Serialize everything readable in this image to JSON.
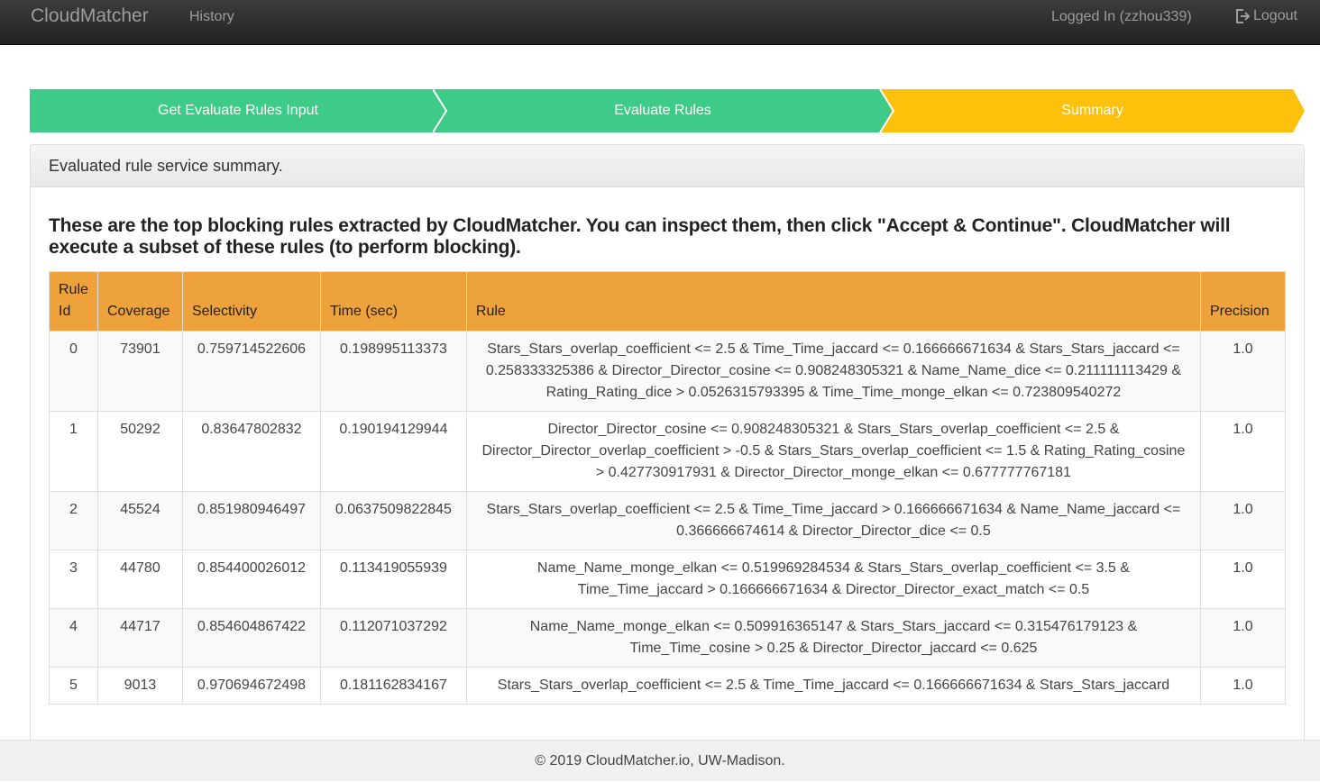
{
  "nav": {
    "brand": "CloudMatcher",
    "history": "History",
    "user": "Logged In (zzhou339)",
    "logout": "Logout",
    "logout_icon": "logout-icon"
  },
  "steps": [
    {
      "label": "Get Evaluate Rules Input",
      "color": "#3ecb88"
    },
    {
      "label": "Evaluate Rules",
      "color": "#3ecb88"
    },
    {
      "label": "Summary",
      "color": "#fdc10c"
    }
  ],
  "panel": {
    "heading": "Evaluated rule service summary.",
    "intro": "These are the top blocking rules extracted by CloudMatcher. You can inspect them, then click \"Accept & Continue\". CloudMatcher will execute a subset of these rules (to perform blocking)."
  },
  "table": {
    "headers": {
      "rule_id": "Rule Id",
      "coverage": "Coverage",
      "selectivity": "Selectivity",
      "time": "Time (sec)",
      "rule": "Rule",
      "precision": "Precision"
    },
    "header_color": "#eea23b",
    "rows": [
      {
        "id": "0",
        "coverage": "73901",
        "selectivity": "0.759714522606",
        "time": "0.198995113373",
        "rule": "Stars_Stars_overlap_coefficient <= 2.5 & Time_Time_jaccard <= 0.166666671634 & Stars_Stars_jaccard <= 0.258333325386 & Director_Director_cosine <= 0.908248305321 & Name_Name_dice <= 0.211111113429 & Rating_Rating_dice > 0.0526315793395 & Time_Time_monge_elkan <= 0.723809540272",
        "precision": "1.0"
      },
      {
        "id": "1",
        "coverage": "50292",
        "selectivity": "0.83647802832",
        "time": "0.190194129944",
        "rule": "Director_Director_cosine <= 0.908248305321 & Stars_Stars_overlap_coefficient <= 2.5 & Director_Director_overlap_coefficient > -0.5 & Stars_Stars_overlap_coefficient <= 1.5 & Rating_Rating_cosine > 0.427730917931 & Director_Director_monge_elkan <= 0.677777767181",
        "precision": "1.0"
      },
      {
        "id": "2",
        "coverage": "45524",
        "selectivity": "0.851980946497",
        "time": "0.0637509822845",
        "rule": "Stars_Stars_overlap_coefficient <= 2.5 & Time_Time_jaccard > 0.166666671634 & Name_Name_jaccard <= 0.366666674614 & Director_Director_dice <= 0.5",
        "precision": "1.0"
      },
      {
        "id": "3",
        "coverage": "44780",
        "selectivity": "0.854400026012",
        "time": "0.113419055939",
        "rule": "Name_Name_monge_elkan <= 0.519969284534 & Stars_Stars_overlap_coefficient <= 3.5 & Time_Time_jaccard > 0.166666671634 & Director_Director_exact_match <= 0.5",
        "precision": "1.0"
      },
      {
        "id": "4",
        "coverage": "44717",
        "selectivity": "0.854604867422",
        "time": "0.112071037292",
        "rule": "Name_Name_monge_elkan <= 0.509916365147 & Stars_Stars_jaccard <= 0.315476179123 & Time_Time_cosine > 0.25 & Director_Director_jaccard <= 0.625",
        "precision": "1.0"
      },
      {
        "id": "5",
        "coverage": "9013",
        "selectivity": "0.970694672498",
        "time": "0.181162834167",
        "rule": "Stars_Stars_overlap_coefficient <= 2.5 & Time_Time_jaccard <= 0.166666671634 & Stars_Stars_jaccard",
        "precision": "1.0"
      }
    ]
  },
  "footer": "© 2019 CloudMatcher.io, UW-Madison."
}
